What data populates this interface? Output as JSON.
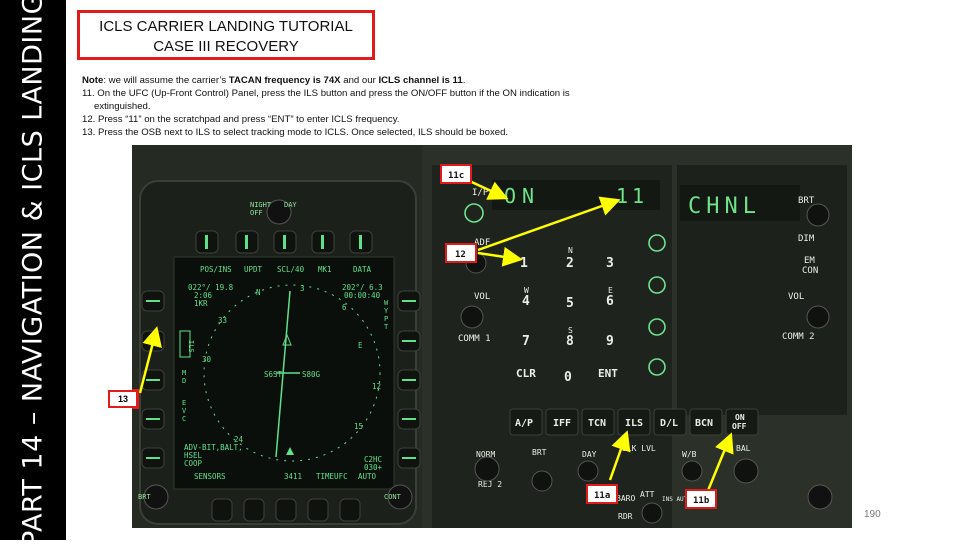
{
  "sidebar": {
    "title": "PART 14 – NAVIGATION & ICLS LANDING"
  },
  "header": {
    "line1": "ICLS CARRIER LANDING TUTORIAL",
    "line2": "CASE III RECOVERY"
  },
  "notes": {
    "note_label": "Note",
    "note_text_1": ": we will assume the carrier’s ",
    "note_bold_1": "TACAN frequency is 74X",
    "note_text_2": " and our ",
    "note_bold_2": "ICLS channel is 11",
    "note_text_3": ".",
    "step11a": "11. On the UFC (Up-Front Control) Panel, press the ILS button and press the ON/OFF button if the ON indication is",
    "step11b": "extinguished.",
    "step12": "12. Press “11” on the scratchpad and press “ENT” to enter ICLS frequency.",
    "step13": "13. Press the OSB next to ILS to select tracking mode to ICLS. Once selected, ILS should be boxed."
  },
  "page_number": "190",
  "colors": {
    "accent_red": "#e01b1b",
    "arrow_yellow": "#ffff00",
    "display_green": "#7fe08a",
    "panel_bg": "#252a22"
  },
  "callouts": {
    "c11c": "11c",
    "c12": "12",
    "c13": "13",
    "c11a": "11a",
    "c11b": "11b"
  },
  "ufc": {
    "option1": "ON",
    "option2": "11",
    "option3": "CHNL",
    "ip": "I/P",
    "adf": "ADF",
    "vol": "VOL",
    "comm1": "COMM 1",
    "comm2": "COMM 2",
    "brt": "BRT",
    "dim": "DIM",
    "emcon_1": "EM",
    "emcon_2": "CON",
    "vol2": "VOL",
    "keys": [
      {
        "top": "",
        "main": "1"
      },
      {
        "top": "N",
        "main": "2"
      },
      {
        "top": "",
        "main": "3"
      },
      {
        "top": "W",
        "main": "4"
      },
      {
        "top": "",
        "main": "5"
      },
      {
        "top": "E",
        "main": "6"
      },
      {
        "top": "",
        "main": "7"
      },
      {
        "top": "S",
        "main": "8"
      },
      {
        "top": "",
        "main": "9"
      },
      {
        "top": "",
        "main": "CLR"
      },
      {
        "top": "",
        "main": "0"
      },
      {
        "top": "",
        "main": "ENT"
      }
    ],
    "func_keys": [
      "A/P",
      "IFF",
      "TCN",
      "ILS",
      "D/L",
      "BCN"
    ],
    "onoff_1": "ON",
    "onoff_2": "OFF",
    "brt2": "BRT",
    "day": "DAY",
    "blk_lvl": "BLK LVL",
    "wb": "W/B",
    "bal": "BAL",
    "norm": "NORM",
    "rej": "REJ 2",
    "att": "ATT",
    "baro": "BARO",
    "rdr": "RDR",
    "ins_auto": "INS AUTO STBY"
  },
  "ddi": {
    "night_day": "NIGHT",
    "day": "DAY",
    "off": "OFF",
    "top_labels": [
      "POS/INS",
      "UPDT",
      "SCL/40",
      "MK1",
      "DATA"
    ],
    "left_lines": [
      "022°/ 19.8",
      "2:06",
      "1KR"
    ],
    "right_lines": [
      "202°/ 6.3",
      "00:00:40"
    ],
    "compass": [
      "33",
      "N",
      "3",
      "30",
      "6",
      "E",
      "12",
      "15",
      "24"
    ],
    "hdg_left": "S6ST",
    "hdg_right": "S80G",
    "bottom_left": [
      "ADV-BIT,BALT,",
      "HSEL",
      "COOP"
    ],
    "bottom_labels": [
      "SENSORS",
      "3411",
      "TIMEUFC",
      "AUTO"
    ],
    "bottom_right": [
      "C2HC",
      "030+"
    ],
    "left_side": [
      "ILS",
      "M",
      "D",
      "E",
      "V",
      "E",
      "C"
    ],
    "right_side": [
      "W",
      "Y",
      "P",
      "T"
    ],
    "brt": "BRT",
    "cont": "CONT"
  }
}
